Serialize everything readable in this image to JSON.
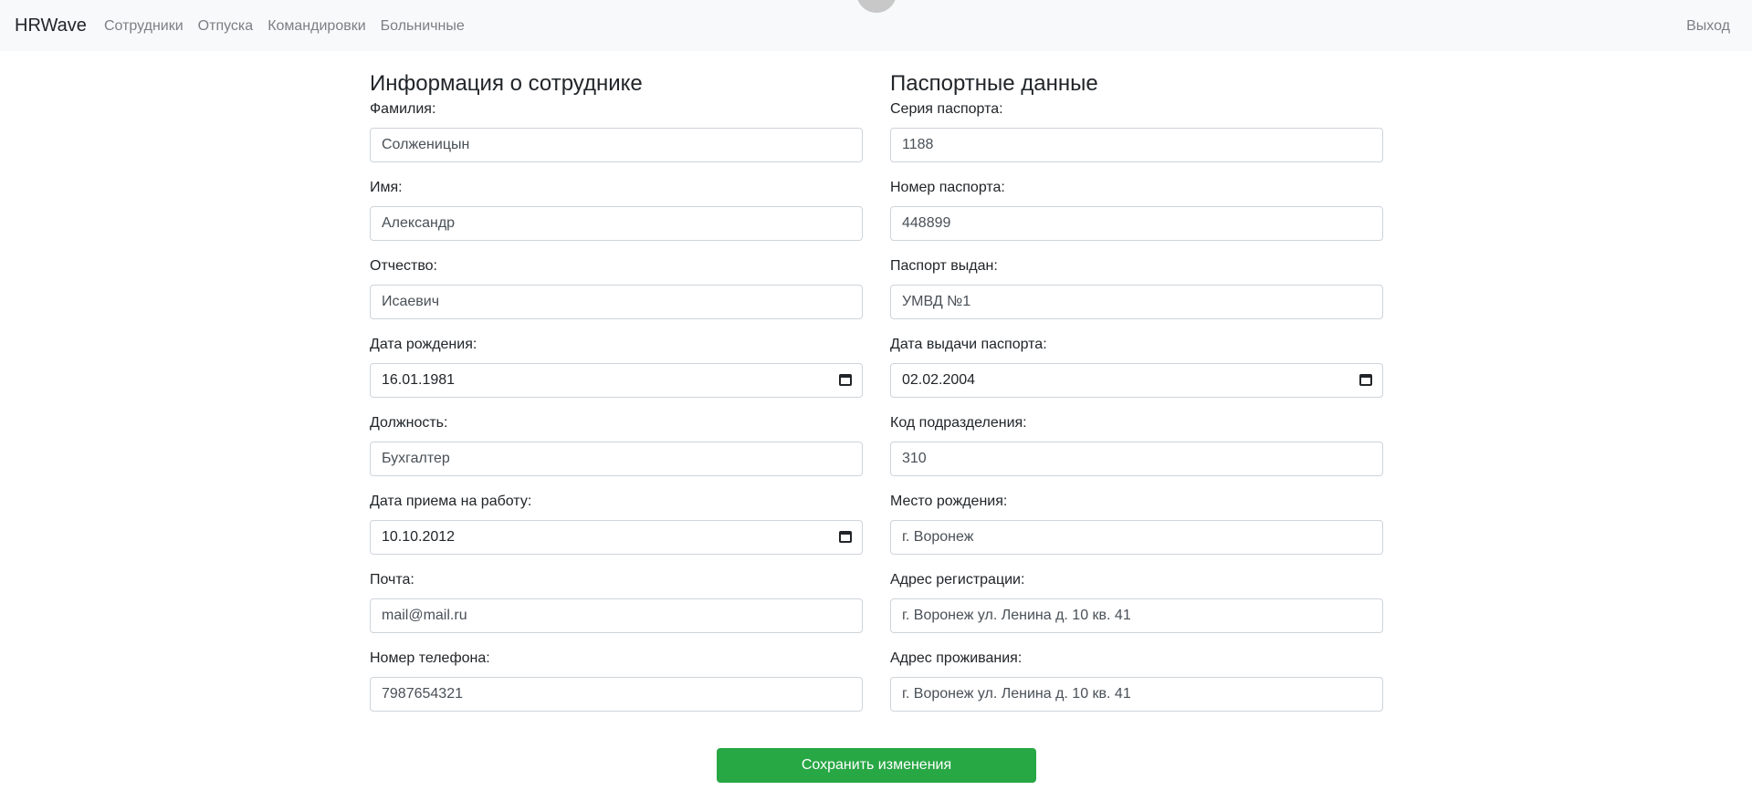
{
  "navbar": {
    "brand": "HRWave",
    "links": [
      "Сотрудники",
      "Отпуска",
      "Командировки",
      "Больничные"
    ],
    "logout": "Выход"
  },
  "employee": {
    "heading": "Информация о сотруднике",
    "fields": [
      {
        "label": "Фамилия:",
        "value": "Солженицын"
      },
      {
        "label": "Имя:",
        "value": "Александр"
      },
      {
        "label": "Отчество:",
        "value": "Исаевич"
      },
      {
        "label": "Дата рождения:",
        "value": "16.01.1981"
      },
      {
        "label": "Должность:",
        "value": "Бухгалтер"
      },
      {
        "label": "Дата приема на работу:",
        "value": "10.10.2012"
      },
      {
        "label": "Почта:",
        "value": "mail@mail.ru"
      },
      {
        "label": "Номер телефона:",
        "value": "7987654321"
      }
    ]
  },
  "passport": {
    "heading": "Паспортные данные",
    "fields": [
      {
        "label": "Серия паспорта:",
        "value": "1188"
      },
      {
        "label": "Номер паспорта:",
        "value": "448899"
      },
      {
        "label": "Паспорт выдан:",
        "value": "УМВД №1"
      },
      {
        "label": "Дата выдачи паспорта:",
        "value": "02.02.2004"
      },
      {
        "label": "Код подразделения:",
        "value": "310"
      },
      {
        "label": "Место рождения:",
        "value": "г. Воронеж"
      },
      {
        "label": "Адрес регистрации:",
        "value": "г. Воронеж ул. Ленина д. 10 кв. 41"
      },
      {
        "label": "Адрес проживания:",
        "value": "г. Воронеж ул. Ленина д. 10 кв. 41"
      }
    ]
  },
  "save_button": "Сохранить изменения"
}
